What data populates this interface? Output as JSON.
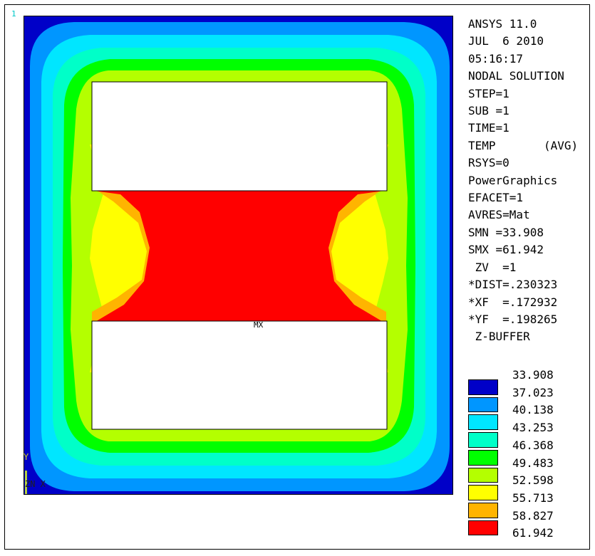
{
  "window_number": "1",
  "info": {
    "lines": [
      "ANSYS 11.0",
      "JUL  6 2010",
      "05:16:17",
      "NODAL SOLUTION",
      "STEP=1",
      "SUB =1",
      "TIME=1",
      "TEMP       (AVG)",
      "RSYS=0",
      "PowerGraphics",
      "EFACET=1",
      "AVRES=Mat",
      "SMN =33.908",
      "SMX =61.942",
      "",
      " ZV  =1",
      "*DIST=.230323",
      "*XF  =.172932",
      "*YF  =.198265",
      " Z-BUFFER"
    ]
  },
  "max_marker": "MX",
  "triad": {
    "y": "Y",
    "zx": "ZN  X"
  },
  "legend": {
    "values": [
      "33.908",
      "37.023",
      "40.138",
      "43.253",
      "46.368",
      "49.483",
      "52.598",
      "55.713",
      "58.827",
      "61.942"
    ],
    "colors": [
      "#0000c8",
      "#0096ff",
      "#00e6ff",
      "#00ffc8",
      "#00ff00",
      "#b4ff00",
      "#ffff00",
      "#ffb400",
      "#ff0000",
      "#ff0000"
    ]
  },
  "contour_colors": [
    "#0000c8",
    "#0096ff",
    "#00e6ff",
    "#00ffc8",
    "#00ff00",
    "#b4ff00",
    "#ffff00",
    "#ffb400",
    "#ff0000"
  ]
}
